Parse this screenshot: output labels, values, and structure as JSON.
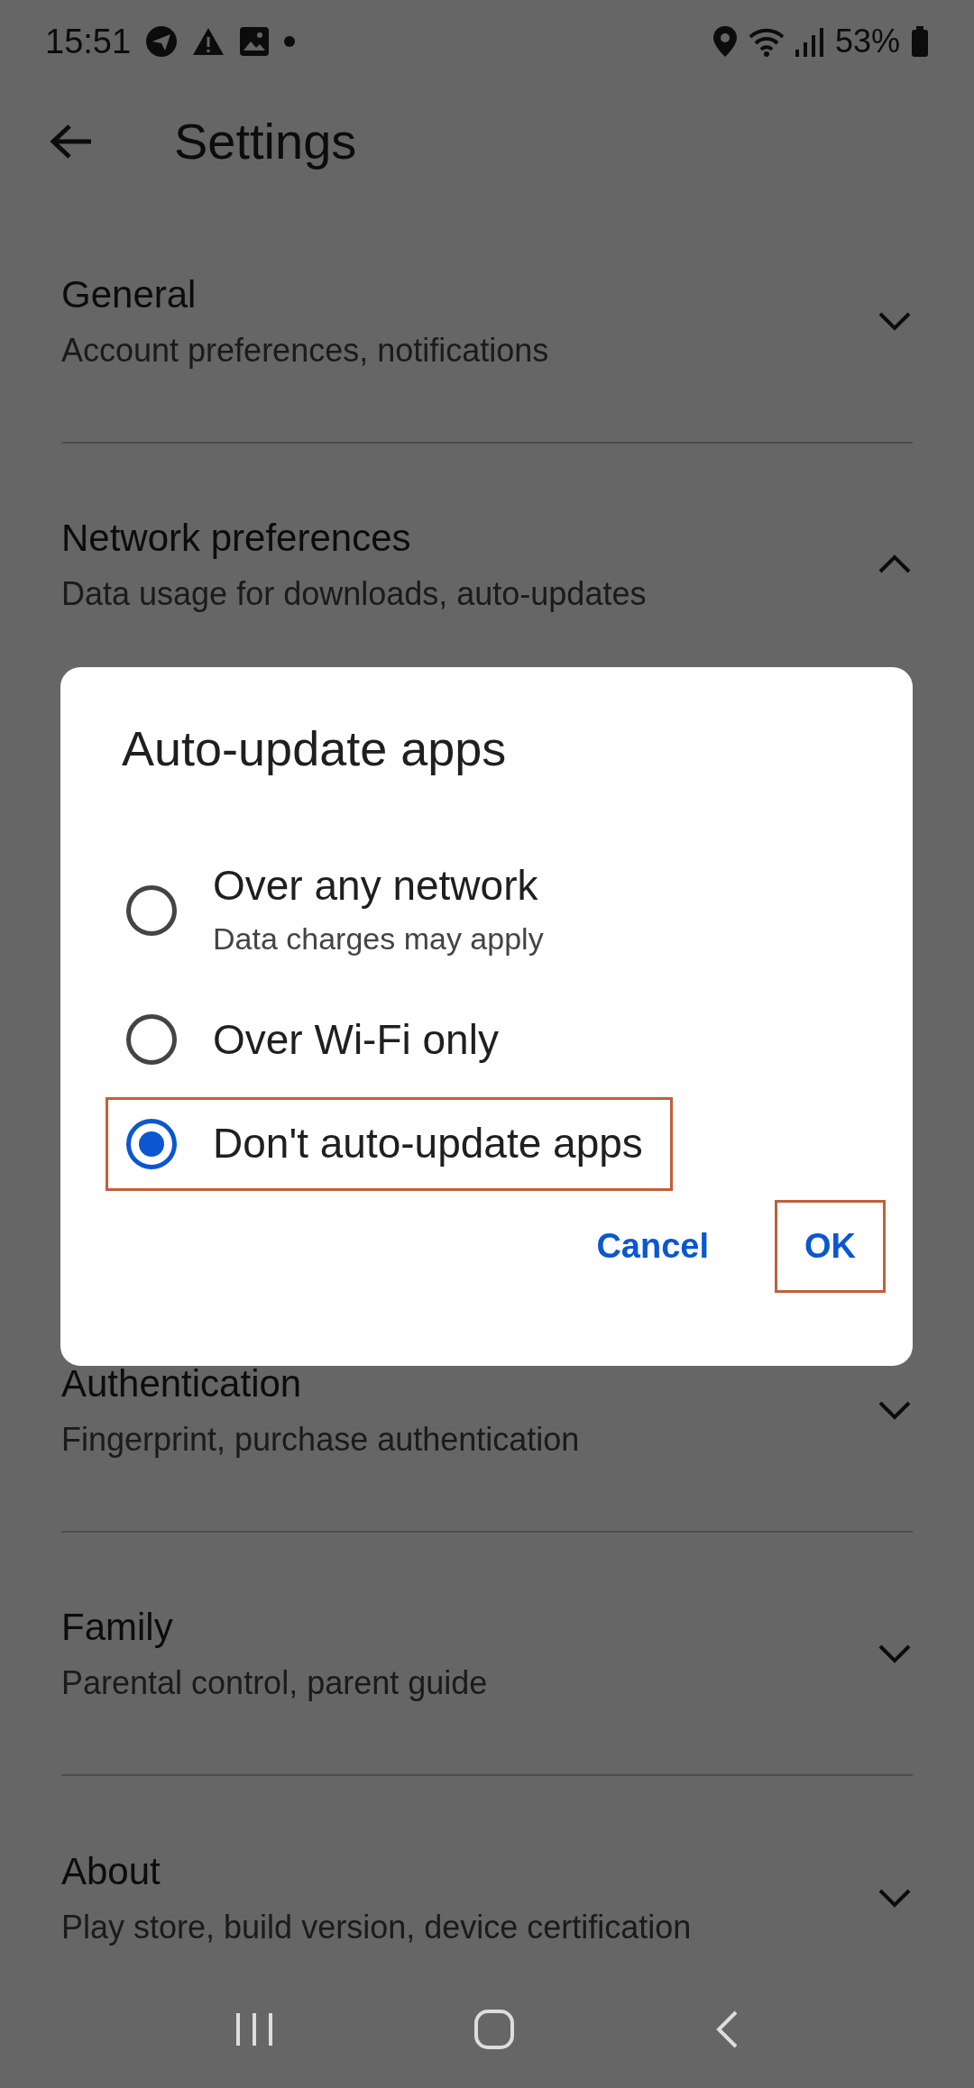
{
  "status_bar": {
    "time": "15:51",
    "battery": "53%"
  },
  "header": {
    "title": "Settings"
  },
  "sections": [
    {
      "title": "General",
      "subtitle": "Account preferences, notifications",
      "expanded": false
    },
    {
      "title": "Network preferences",
      "subtitle": "Data usage for downloads, auto-updates",
      "expanded": true
    },
    {
      "title": "Authentication",
      "subtitle": "Fingerprint, purchase authentication",
      "expanded": false
    },
    {
      "title": "Family",
      "subtitle": "Parental control, parent guide",
      "expanded": false
    },
    {
      "title": "About",
      "subtitle": "Play store, build version, device certification",
      "expanded": false
    }
  ],
  "dialog": {
    "title": "Auto-update apps",
    "options": [
      {
        "label": "Over any network",
        "hint": "Data charges may apply",
        "selected": false,
        "highlighted": false
      },
      {
        "label": "Over Wi-Fi only",
        "selected": false,
        "highlighted": false
      },
      {
        "label": "Don't auto-update apps",
        "selected": true,
        "highlighted": true
      }
    ],
    "buttons": [
      {
        "label": "Cancel",
        "highlighted": false
      },
      {
        "label": "OK",
        "highlighted": true
      }
    ]
  }
}
